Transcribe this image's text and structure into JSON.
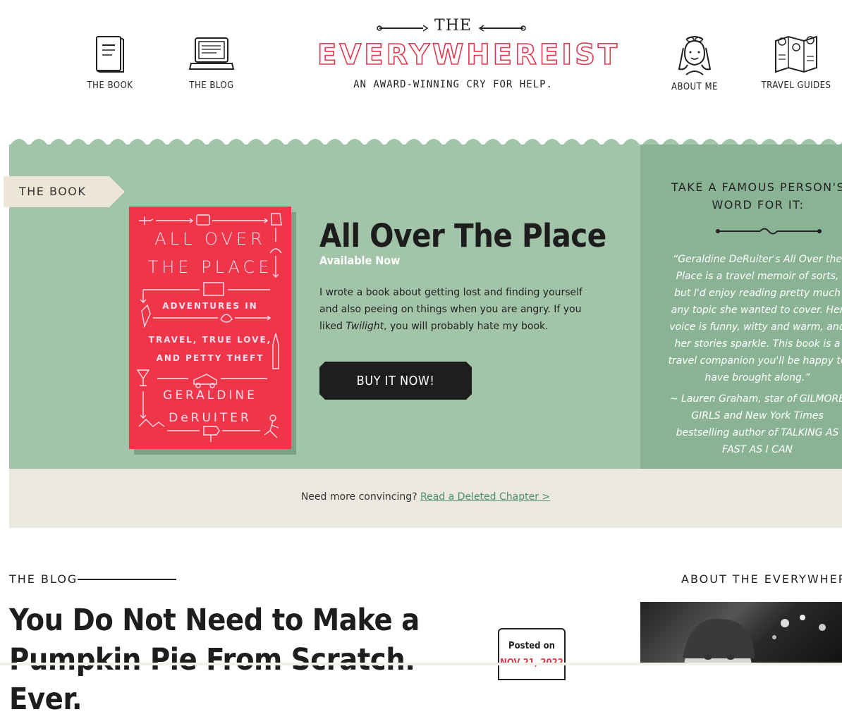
{
  "nav": {
    "book_label": "THE BOOK",
    "blog_label": "THE BLOG",
    "about_label": "ABOUT ME",
    "guides_label": "TRAVEL GUIDES"
  },
  "logo": {
    "the": "THE",
    "name": "EVERYWHEREIST",
    "tagline": "AN AWARD-WINNING CRY FOR HELP."
  },
  "colors": {
    "brand_red": "#e0394f",
    "sage_green": "#a2c4a9",
    "dark_sage": "#8ab395",
    "cream": "#ebe8df",
    "link_green": "#4d8f6d"
  },
  "book": {
    "section_label": "THE BOOK",
    "cover": {
      "title_line1": "ALL OVER",
      "title_line2": "THE PLACE",
      "sub_line1": "ADVENTURES IN",
      "sub_line2": "TRAVEL, TRUE LOVE,",
      "sub_line3": "AND PETTY THEFT",
      "author_line1": "GERALDINE",
      "author_line2": "DeRUITER"
    },
    "title": "All Over The Place",
    "availability": "Available Now",
    "description_part1": "I wrote a book about getting lost and finding yourself and also peeing on things when you are angry. If you liked ",
    "description_italic": "Twilight",
    "description_part2": ", you will probably hate my book.",
    "buy_label": "BUY IT NOW!"
  },
  "quote": {
    "heading_line1": "TAKE A FAMOUS PERSON'S",
    "heading_line2": "WORD FOR IT:",
    "text": "“Geraldine DeRuiter's All Over the Place is a travel memoir of sorts, but I'd enjoy reading pretty much any topic she wanted to cover. Her voice is funny, witty and warm, and her stories sparkle.  This book is a travel companion you'll be happy to have brought along.”",
    "attribution": "~ Lauren Graham, star of GILMORE GIRLS and New York Times bestselling author of TALKING AS FAST AS I CAN"
  },
  "convince": {
    "prompt": "Need more convincing?",
    "link": "Read a Deleted Chapter >"
  },
  "blog": {
    "heading": "THE BLOG",
    "post_title": "You Do Not Need to Make a Pumpkin Pie From Scratch. Ever.",
    "posted_label": "Posted on",
    "posted_date": "NOV 21, 2022"
  },
  "about": {
    "heading": "ABOUT THE EVERYWHEREIST"
  }
}
